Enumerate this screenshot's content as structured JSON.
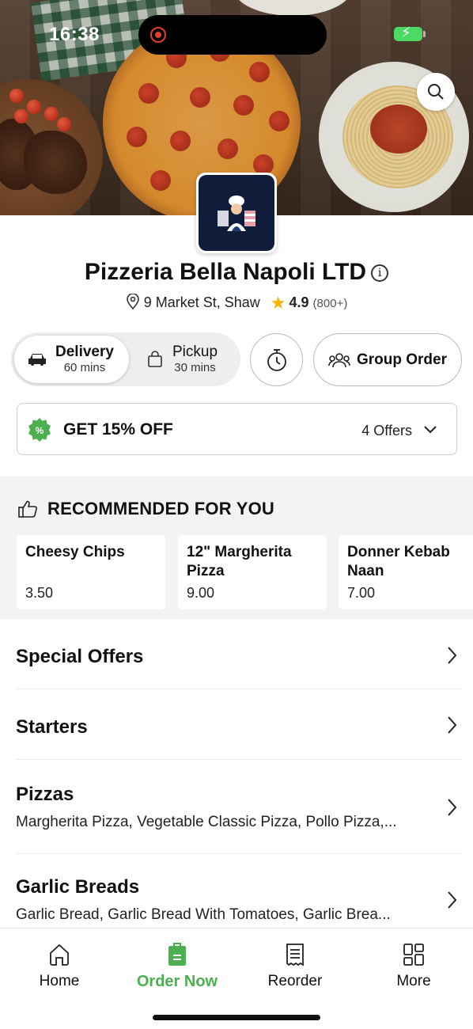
{
  "status_bar": {
    "time": "16:38"
  },
  "restaurant": {
    "name": "Pizzeria Bella Napoli LTD",
    "address": "9 Market St, Shaw",
    "rating": "4.9",
    "rating_count": "(800+)"
  },
  "order_mode": {
    "delivery": {
      "label": "Delivery",
      "time": "60 mins",
      "selected": true
    },
    "pickup": {
      "label": "Pickup",
      "time": "30 mins",
      "selected": false
    },
    "group_order_label": "Group Order"
  },
  "offers": {
    "title": "GET 15% OFF",
    "count_label": "4 Offers"
  },
  "recommended": {
    "heading": "RECOMMENDED FOR YOU",
    "items": [
      {
        "name": "Cheesy Chips",
        "price": "3.50"
      },
      {
        "name": "12\" Margherita Pizza",
        "price": "9.00"
      },
      {
        "name": "Donner Kebab Naan",
        "price": "7.00"
      }
    ]
  },
  "categories": [
    {
      "name": "Special Offers",
      "description": ""
    },
    {
      "name": "Starters",
      "description": ""
    },
    {
      "name": "Pizzas",
      "description": "Margherita Pizza, Vegetable Classic Pizza, Pollo Pizza,..."
    },
    {
      "name": "Garlic Breads",
      "description": "Garlic Bread, Garlic Bread With Tomatoes, Garlic Brea..."
    }
  ],
  "bottom_nav": [
    {
      "label": "Home",
      "icon": "home-icon",
      "active": false
    },
    {
      "label": "Order Now",
      "icon": "order-bag-icon",
      "active": true
    },
    {
      "label": "Reorder",
      "icon": "receipt-icon",
      "active": false
    },
    {
      "label": "More",
      "icon": "grid-icon",
      "active": false
    }
  ],
  "colors": {
    "accent": "#4caf50",
    "star": "#f5b400",
    "recording": "#e0402d"
  }
}
